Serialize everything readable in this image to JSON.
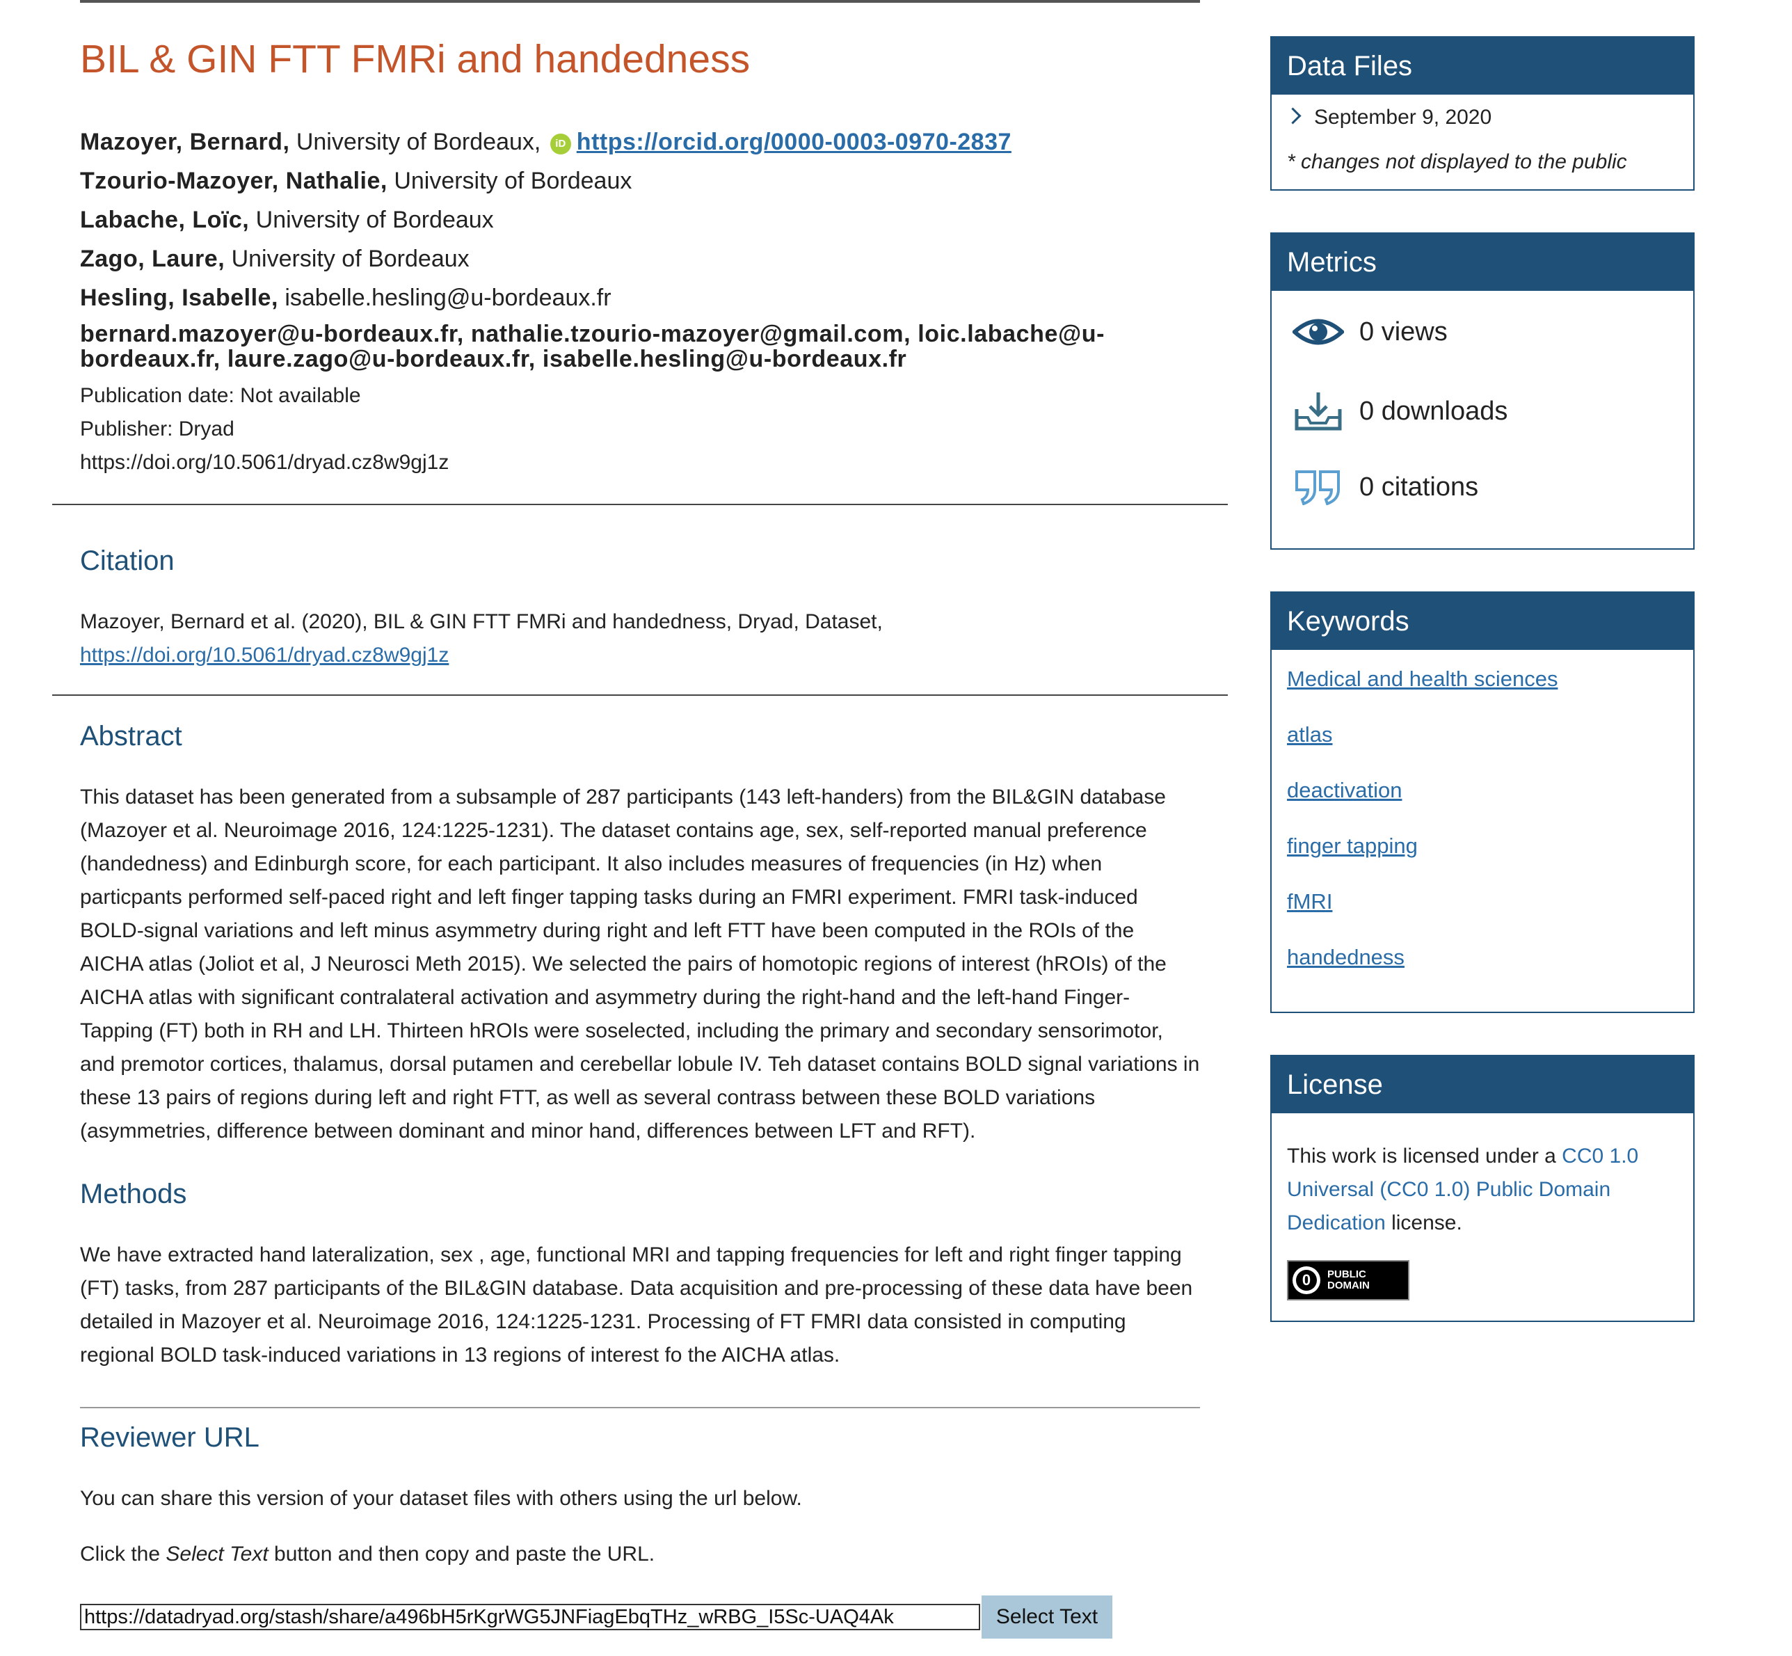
{
  "dataset": {
    "title": "BIL & GIN FTT FMRi and handedness",
    "authors": [
      {
        "name": "Mazoyer, Bernard,",
        "affiliation": "University of Bordeaux,"
      },
      {
        "name": "Tzourio-Mazoyer, Nathalie,",
        "affiliation": "University of Bordeaux"
      },
      {
        "name": "Labache, Loïc,",
        "affiliation": "University of Bordeaux"
      },
      {
        "name": "Zago, Laure,",
        "affiliation": "University of Bordeaux"
      },
      {
        "name": "Hesling, Isabelle,",
        "affiliation": "isabelle.hesling@u-bordeaux.fr"
      }
    ],
    "orcid_url": "https://orcid.org/0000-0003-0970-2837",
    "orcid_icon": "orcid-icon",
    "emails": "bernard.mazoyer@u-bordeaux.fr, nathalie.tzourio-mazoyer@gmail.com, loic.labache@u-bordeaux.fr, laure.zago@u-bordeaux.fr, isabelle.hesling@u-bordeaux.fr",
    "publication_date": "Publication date: Not available",
    "publisher": "Publisher: Dryad",
    "doi": "https://doi.org/10.5061/dryad.cz8w9gj1z"
  },
  "citation": {
    "heading": "Citation",
    "text": "Mazoyer, Bernard et al. (2020), BIL & GIN FTT FMRi and handedness, Dryad, Dataset,",
    "link": "https://doi.org/10.5061/dryad.cz8w9gj1z"
  },
  "abstract": {
    "heading": "Abstract",
    "text": "This dataset has been generated from a subsample of 287 participants (143 left-handers) from the BIL&GIN database (Mazoyer et al. Neuroimage 2016, 124:1225-1231). The dataset contains age, sex, self-reported manual preference (handedness) and Edinburgh score, for each participant. It also includes measures of frequencies (in Hz) when particpants performed self-paced right and left finger tapping tasks during an FMRI experiment. FMRI task-induced BOLD-signal variations and left minus asymmetry during right and left FTT have been computed in the ROIs of the AICHA atlas (Joliot et al, J Neurosci Meth 2015). We selected the pairs of homotopic regions of interest (hROIs) of the AICHA atlas with significant contralateral activation and asymmetry during the right-hand and the left-hand Finger-Tapping (FT) both in RH and LH. Thirteen hROIs were soselected, including the primary and secondary sensorimotor, and premotor cortices, thalamus, dorsal putamen and cerebellar lobule IV. Teh dataset contains BOLD signal variations in these 13 pairs of regions during left and right FTT, as well as several contrass between these BOLD variations (asymmetries, difference between dominant and minor hand, differences between LFT and RFT)."
  },
  "methods": {
    "heading": "Methods",
    "text": "We have extracted hand lateralization, sex , age, functional MRI and tapping frequencies for left and right finger tapping (FT) tasks, from 287 participants of the BIL&GIN database. Data acquisition and pre-processing of these data have been detailed in Mazoyer et al. Neuroimage 2016, 124:1225-1231. Processing of FT FMRI data consisted in computing regional BOLD task-induced variations in 13 regions of interest fo the AICHA atlas."
  },
  "reviewer": {
    "heading": "Reviewer URL",
    "text1": "You can share this version of your dataset files with others using the url below.",
    "text2_before": "Click the ",
    "text2_em": "Select Text",
    "text2_after": " button and then copy and paste the URL.",
    "url_value": "https://datadryad.org/stash/share/a496bH5rKgrWG5JNFiagEbqTHz_wRBG_I5Sc-UAQ4Ak",
    "button_label": "Select Text"
  },
  "sidebar": {
    "data_files": {
      "heading": "Data Files",
      "version_date": "September 9, 2020",
      "note": "* changes not displayed to the public"
    },
    "metrics": {
      "heading": "Metrics",
      "items": [
        {
          "icon": "eye-icon",
          "label": "0 views"
        },
        {
          "icon": "download-icon",
          "label": "0 downloads"
        },
        {
          "icon": "quote-icon",
          "label": "0 citations"
        }
      ]
    },
    "keywords": {
      "heading": "Keywords",
      "items": [
        "Medical and health sciences",
        "atlas",
        "deactivation",
        "finger tapping",
        "fMRI",
        "handedness"
      ]
    },
    "license": {
      "heading": "License",
      "text_before": "This work is licensed under a ",
      "link": "CC0 1.0 Universal (CC0 1.0) Public Domain Dedication",
      "text_after": " license.",
      "badge_icon": "public-domain-icon",
      "badge_line1": "PUBLIC",
      "badge_line2": "DOMAIN"
    }
  },
  "colors": {
    "title": "#c4552b",
    "heading": "#1f5077",
    "link": "#2a6ca8",
    "panel_header": "#1f5077",
    "button": "#a9c7d8",
    "orcid": "#a6ce39"
  }
}
